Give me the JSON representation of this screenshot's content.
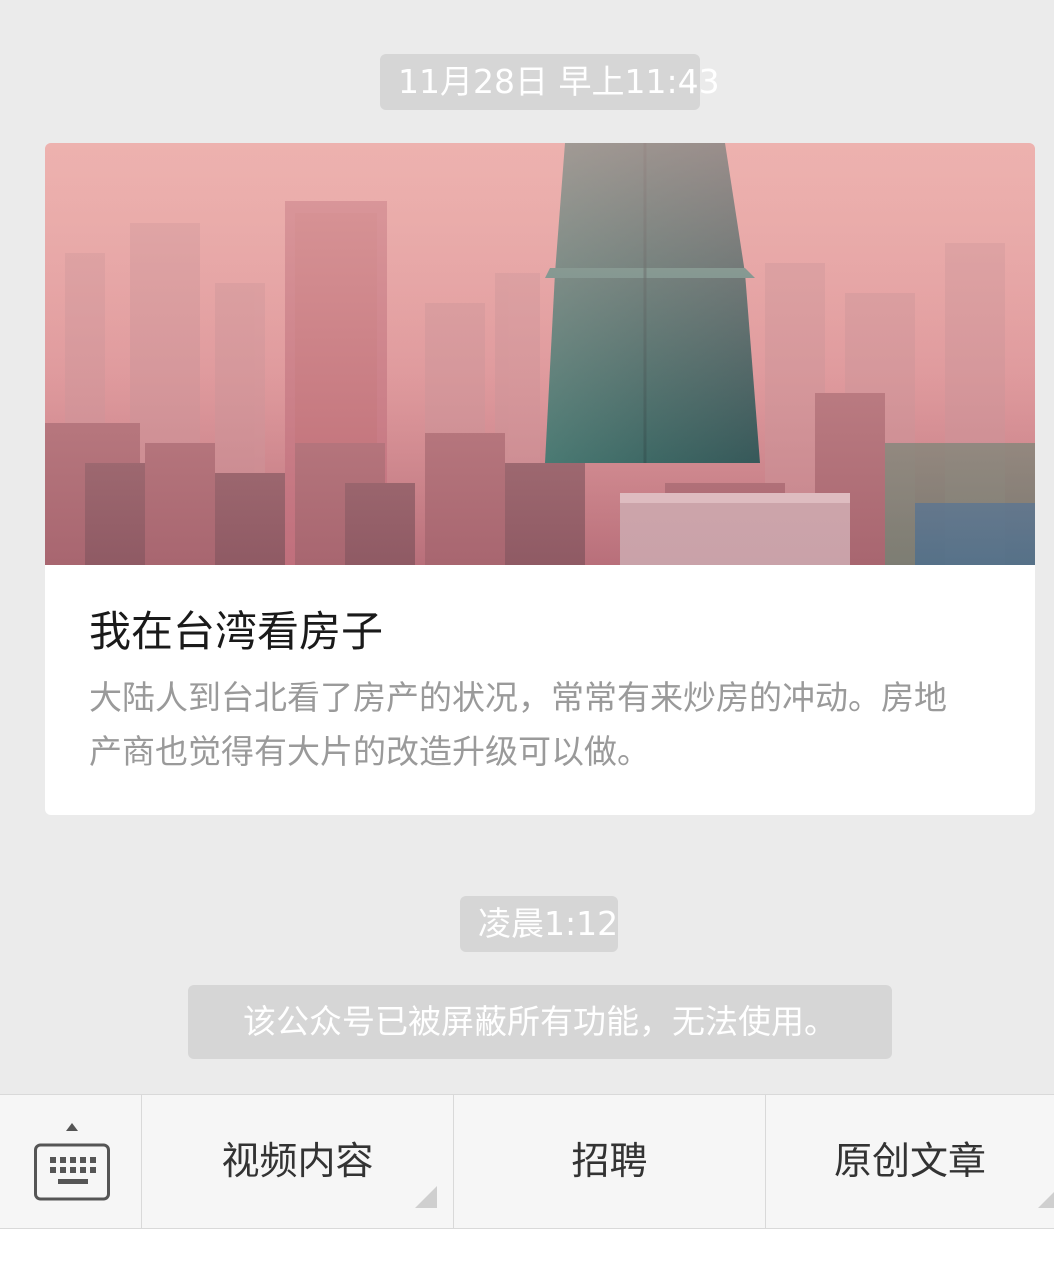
{
  "messages": {
    "timestamp_1": "11月28日 早上11:43",
    "timestamp_2": "凌晨1:12",
    "article": {
      "title": "我在台湾看房子",
      "description": "大陆人到台北看了房产的状况，常常有来炒房的冲动。房地产商也觉得有大片的改造升级可以做。"
    },
    "system_notice": "该公众号已被屏蔽所有功能，无法使用。"
  },
  "menu": {
    "keyboard_icon": "keyboard-icon",
    "items": [
      {
        "label": "视频内容",
        "has_submenu": true
      },
      {
        "label": "招聘",
        "has_submenu": false
      },
      {
        "label": "原创文章",
        "has_submenu": true
      }
    ]
  },
  "colors": {
    "chat_background": "#ebebeb",
    "pill_background": "#d6d6d6",
    "menu_background": "#f6f6f6"
  }
}
